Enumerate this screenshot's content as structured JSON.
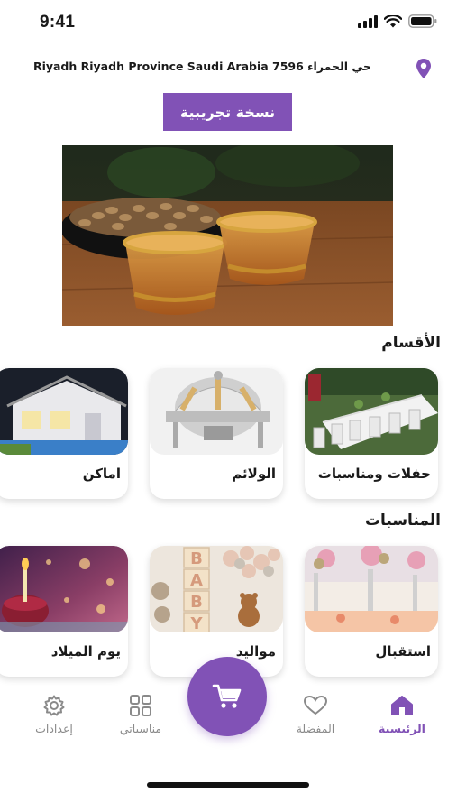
{
  "status_bar": {
    "time": "9:41"
  },
  "location": {
    "address": "Riyadh Riyadh Province Saudi Arabia 7596 حي الحمراء"
  },
  "trial_badge": {
    "label": "نسخة تجريبية"
  },
  "sections": {
    "categories": {
      "title": "الأقسام",
      "items": [
        {
          "label": "حفلات ومناسبات"
        },
        {
          "label": "الولائم"
        },
        {
          "label": "اماكن"
        }
      ]
    },
    "occasions": {
      "title": "المناسبات",
      "items": [
        {
          "label": "استقبال"
        },
        {
          "label": "مواليد"
        },
        {
          "label": "يوم الميلاد"
        }
      ]
    }
  },
  "bottom_nav": {
    "items": [
      {
        "label": "الرئيسية",
        "icon": "home-icon",
        "active": true
      },
      {
        "label": "المفضلة",
        "icon": "heart-icon",
        "active": false
      },
      {
        "label": "مناسباتي",
        "icon": "grid-icon",
        "active": false
      },
      {
        "label": "إعدادات",
        "icon": "gear-icon",
        "active": false
      }
    ],
    "cart_icon": "cart-icon"
  },
  "colors": {
    "accent": "#8152b6",
    "inactive": "#8a8a8a"
  }
}
